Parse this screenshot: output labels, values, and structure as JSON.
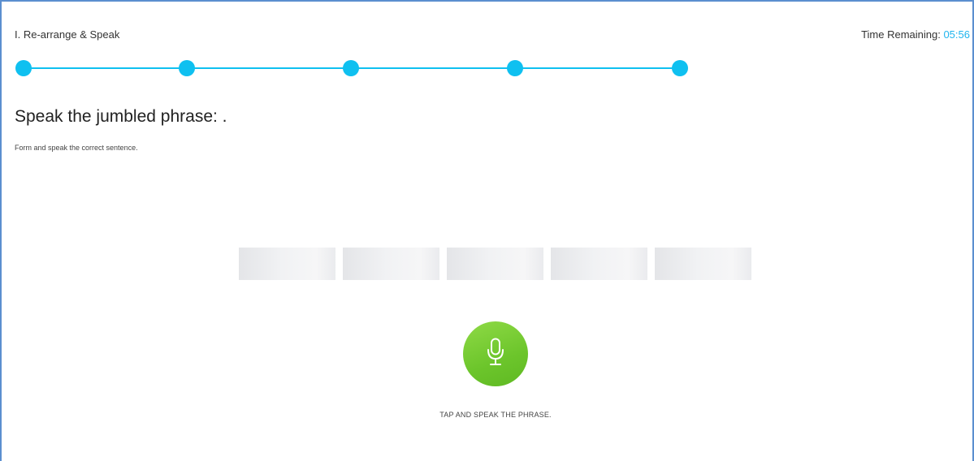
{
  "header": {
    "section_title": "I. Re-arrange & Speak",
    "timer_label": "Time Remaining: ",
    "timer_value": "05:56"
  },
  "progress": {
    "steps_total": 5,
    "steps_shown": 5,
    "color": "#0fc0f0"
  },
  "question": {
    "prompt": "Speak the jumbled phrase: .",
    "instruction": "Form and speak the correct sentence."
  },
  "word_slots": {
    "count": 5,
    "labels": [
      "",
      "",
      "",
      "",
      ""
    ]
  },
  "mic": {
    "icon": "microphone-icon",
    "color": "#6cc52b",
    "caption": "TAP AND SPEAK THE PHRASE."
  },
  "colors": {
    "accent": "#20b5ee",
    "frame_border": "#5b8fcf"
  }
}
